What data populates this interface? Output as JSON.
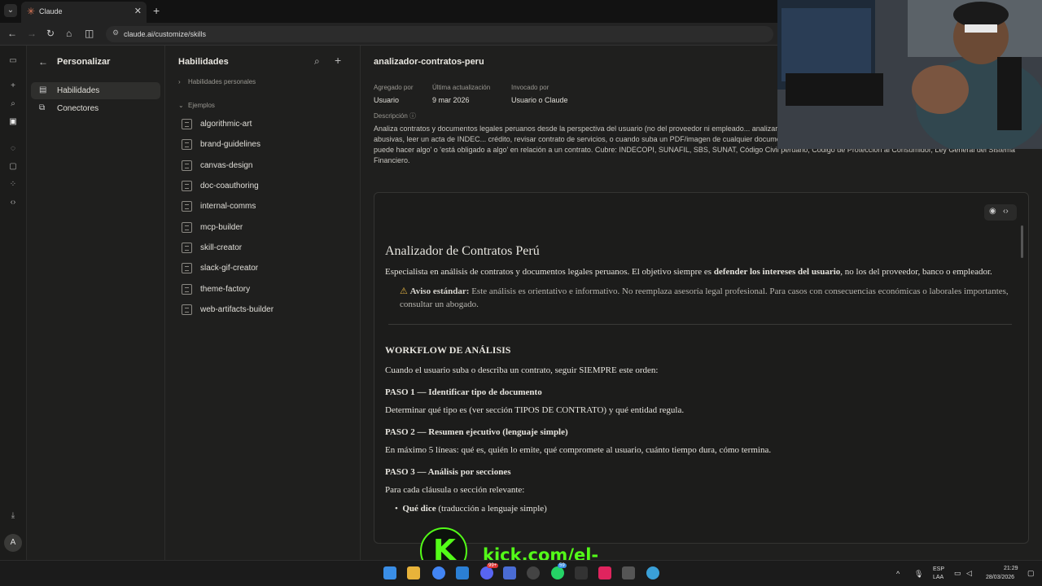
{
  "browser": {
    "tab_title": "Claude",
    "url": "claude.ai/customize/skills"
  },
  "customize": {
    "title": "Personalizar",
    "items": [
      {
        "label": "Habilidades",
        "icon": "skills-icon"
      },
      {
        "label": "Conectores",
        "icon": "connectors-icon"
      }
    ]
  },
  "skills": {
    "title": "Habilidades",
    "personal_group": "Habilidades personales",
    "examples_group": "Ejemplos",
    "items": [
      "algorithmic-art",
      "brand-guidelines",
      "canvas-design",
      "doc-coauthoring",
      "internal-comms",
      "mcp-builder",
      "skill-creator",
      "slack-gif-creator",
      "theme-factory",
      "web-artifacts-builder"
    ]
  },
  "detail": {
    "name": "analizador-contratos-peru",
    "added_by_label": "Agregado por",
    "added_by": "Usuario",
    "updated_label": "Última actualización",
    "updated": "9 mar 2026",
    "invoked_label": "Invocado por",
    "invoked": "Usuario o Claude",
    "desc_label": "Descripción",
    "description": "Analiza contratos y documentos legales peruanos desde la perspectiva del usuario (no del proveedor ni empleado... analizar un documento legal, entender qué dice un contrato, identificar cláusulas abusivas, leer un acta de INDEC... crédito, revisar contrato de servicios, o cuando suba un PDF/imagen de cualquier documento legal o contractual. También activar cuando el usuario pregunte si puede hacer algo' o 'está obligado a algo' en relación a un contrato. Cubre: INDECOPI, SUNAFIL, SBS, SUNAT, Código Civil peruano, Código de Protección al Consumidor, Ley General del Sistema Financiero."
  },
  "doc": {
    "h1": "Analizador de Contratos Perú",
    "intro_a": "Especialista en análisis de contratos y documentos legales peruanos. El objetivo siempre es ",
    "intro_b": "defender los intereses del usuario",
    "intro_c": ", no los del proveedor, banco o empleador.",
    "warn_b": "Aviso estándar:",
    "warn_t": " Este análisis es orientativo e informativo. No reemplaza asesoría legal profesional. Para casos con consecuencias económicas o laborales importantes, consultar un abogado.",
    "workflow": "WORKFLOW DE ANÁLISIS",
    "workflow_p": "Cuando el usuario suba o describa un contrato, seguir SIEMPRE este orden:",
    "paso1": "PASO 1 — Identificar tipo de documento",
    "paso1_p": "Determinar qué tipo es (ver sección TIPOS DE CONTRATO) y qué entidad regula.",
    "paso2": "PASO 2 — Resumen ejecutivo (lenguaje simple)",
    "paso2_p": "En máximo 5 líneas: qué es, quién lo emite, qué compromete al usuario, cuánto tiempo dura, cómo termina.",
    "paso3": "PASO 3 — Análisis por secciones",
    "paso3_p": "Para cada cláusula o sección relevante:",
    "li1_b": "Qué dice",
    "li1_t": " (traducción a lenguaje simple)"
  },
  "overlay": {
    "kick_letter": "K",
    "kick_text": "kick.com/el-cuchiof"
  },
  "system": {
    "lang": "ESP",
    "lang2": "LAA",
    "time": "21:29",
    "date": "28/03/2026",
    "badge1": "99+",
    "badge2": "59"
  },
  "avatar": "A"
}
